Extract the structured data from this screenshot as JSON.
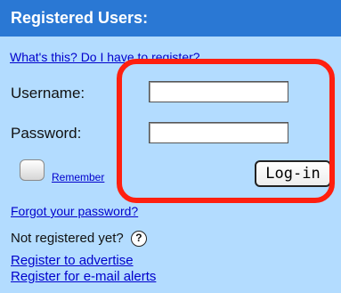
{
  "header": {
    "title": "Registered Users:"
  },
  "links": {
    "help": "What's this? Do I have to register?",
    "remember": "Remember",
    "forgot": "Forgot your password?",
    "register_advertise": "Register to advertise",
    "register_alerts": "Register for e-mail alerts"
  },
  "form": {
    "username_label": "Username:",
    "password_label": "Password:",
    "username_value": "",
    "password_value": "",
    "login_label": "Log-in"
  },
  "footer": {
    "not_registered": "Not registered yet?",
    "help_glyph": "?"
  },
  "icons": {
    "help": "question-circle-icon"
  },
  "colors": {
    "header_bg": "#2a78d4",
    "panel_bg": "#b3dcff",
    "link": "#0000cc",
    "highlight": "#ff1f0f"
  }
}
